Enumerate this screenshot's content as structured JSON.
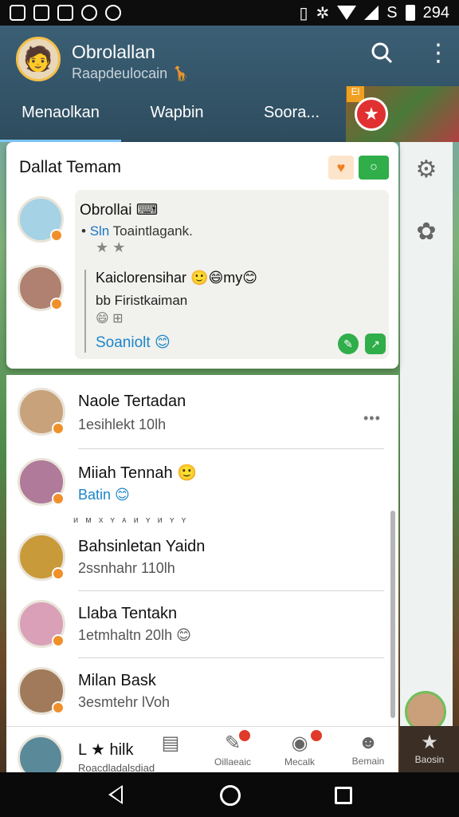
{
  "status_bar": {
    "time": "294"
  },
  "header": {
    "title": "Obrolallan",
    "subtitle": "Raapdeulocain 🦒",
    "tabs": [
      "Menaolkan",
      "Wapbin",
      "Soora..."
    ],
    "game_badge": "El"
  },
  "friends_card": {
    "title": "Dallat Temam",
    "bubble": {
      "title": "Obrollai ⌨",
      "line1_prefix": "Sln",
      "line1_rest": " Toaintlagank.",
      "stars": "★ ★",
      "quote_line1": "Kaiclorensihar 🙂😄my😊",
      "quote_line2": "bb Firistkaiman",
      "quote_line3": "😄 ⊞",
      "link_text": "Soaniolt 😊"
    }
  },
  "chats": [
    {
      "name": "Naole Tertadan",
      "sub": "1esihlekt 10lh"
    },
    {
      "name": "Miiah Tennah 🙂",
      "sub": "Batin 😊",
      "sub_blue": true
    },
    {
      "name": "Bahsinletan Yaidn",
      "sub": "2ssnhahr 110lh"
    },
    {
      "name": "Llaba Tentakn",
      "sub": "1etmhaltn 20lh 😊"
    },
    {
      "name": "Milan Bask",
      "sub": "3esmtehr lVoh"
    }
  ],
  "list_tiny_text": "ᴎ ᴍ x ʏ ᴀ ᴎ ʏ ᴎ ʏ ʏ",
  "bottom_nav": {
    "contact_name": "L",
    "contact_suffix": "hilk",
    "contact_sub": "Roacdladalsdiad",
    "items": [
      {
        "label": "",
        "icon": "list-icon"
      },
      {
        "label": "Oillaeaic",
        "icon": "pen-icon"
      },
      {
        "label": "Mecalk",
        "icon": "map-pin-icon"
      },
      {
        "label": "Bemain",
        "icon": "profile-icon"
      }
    ],
    "side_label": "Baosin"
  },
  "colors": {
    "accent": "#2fae4a",
    "link": "#1b86c8",
    "header": "#2e4c5e"
  }
}
